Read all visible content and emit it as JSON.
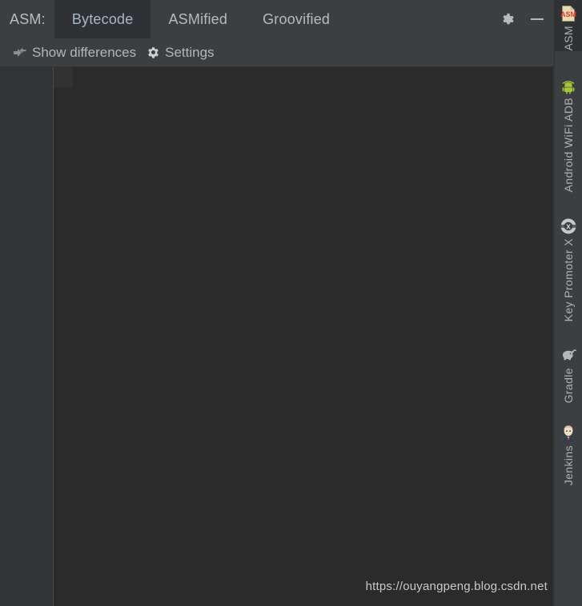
{
  "tabbar": {
    "label": "ASM:",
    "tabs": [
      {
        "label": "Bytecode",
        "active": true
      },
      {
        "label": "ASMified",
        "active": false
      },
      {
        "label": "Groovified",
        "active": false
      }
    ],
    "actions": [
      {
        "name": "settings-gear-icon",
        "label": "gear-icon"
      },
      {
        "name": "minimize-icon",
        "label": "minimize-icon"
      }
    ]
  },
  "toolbar": {
    "show_differences_label": "Show differences",
    "show_differences_icon": "diff-arrows-icon",
    "settings_label": "Settings",
    "settings_icon": "gear-icon"
  },
  "editor": {
    "content": "",
    "watermark": "https://ouyangpeng.blog.csdn.net"
  },
  "stripe": {
    "items": [
      {
        "label": "ASM",
        "icon": "asm-document-icon",
        "selected": true
      },
      {
        "label": "Android WiFi ADB",
        "icon": "android-wifi-icon",
        "selected": false
      },
      {
        "label": "Key Promoter X",
        "icon": "key-promoter-x-icon",
        "selected": false
      },
      {
        "label": "Gradle",
        "icon": "gradle-elephant-icon",
        "selected": false
      },
      {
        "label": "Jenkins",
        "icon": "jenkins-butler-icon",
        "selected": false
      }
    ]
  },
  "colors": {
    "chrome": "#3c3f41",
    "editor_bg": "#2b2b2b",
    "gutter_bg": "#313335",
    "active_tab_bg": "#2f3134",
    "text": "#b9b9b9",
    "accent_text": "#a9b7c6",
    "android_green": "#a4c639",
    "asm_red": "#e8372b"
  }
}
